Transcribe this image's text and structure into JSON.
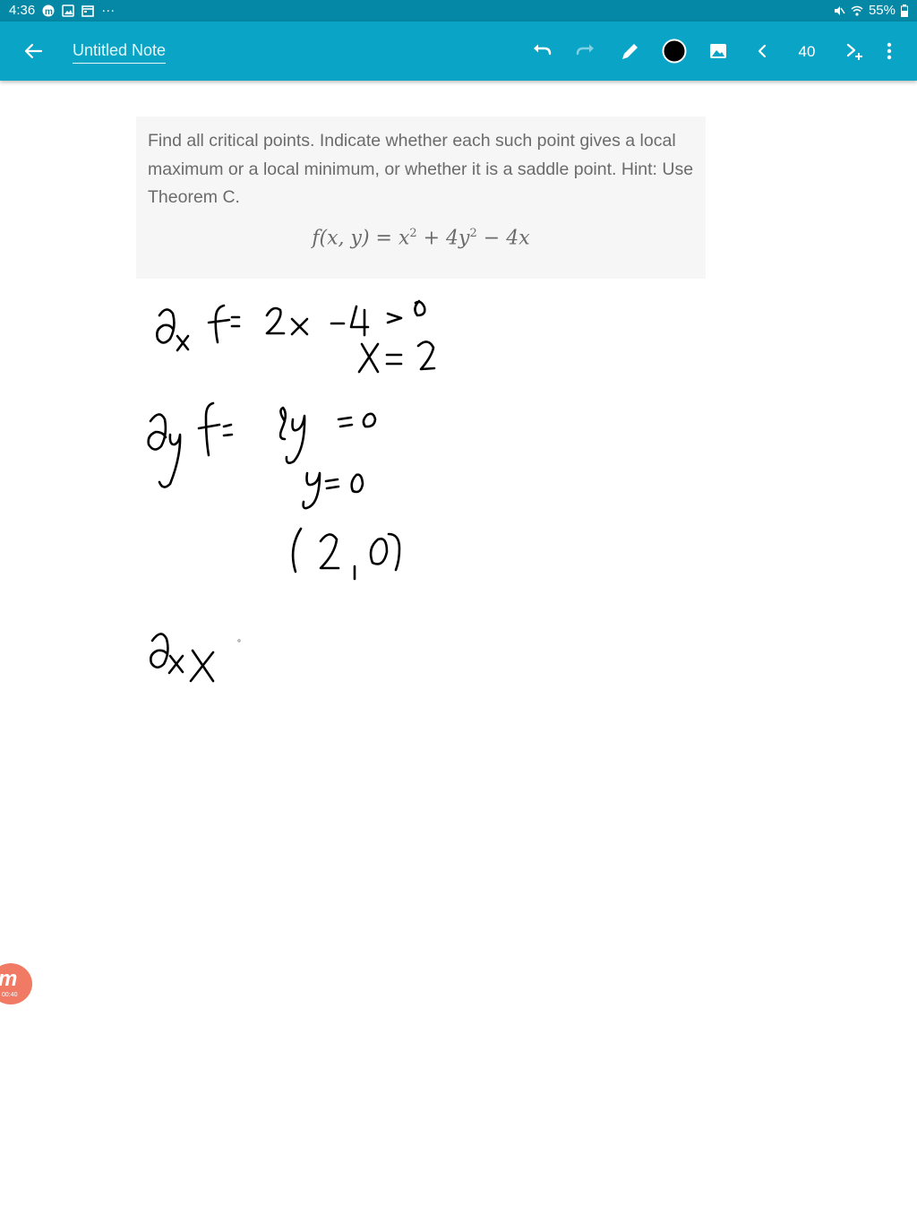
{
  "status_bar": {
    "time": "4:36",
    "more": "···",
    "battery": "55%"
  },
  "toolbar": {
    "title": "Untitled Note",
    "page_number": "40",
    "icons": [
      "back-arrow-icon",
      "undo-icon",
      "redo-icon",
      "pen-icon",
      "color-dot-icon",
      "image-icon",
      "chevron-left-icon",
      "add-page-icon",
      "more-vert-icon"
    ],
    "accent": "#0aa5c6"
  },
  "problem": {
    "text": "Find all critical points. Indicate whether each such point gives a local maximum or a local minimum, or whether it is a saddle point. Hint: Use Theorem C.",
    "formula_lhs": "f(x, y) = x",
    "formula_mid": " + 4y",
    "formula_end": " − 4x",
    "exp1": "2",
    "exp2": "2"
  },
  "recorder": {
    "time": "00:40"
  }
}
